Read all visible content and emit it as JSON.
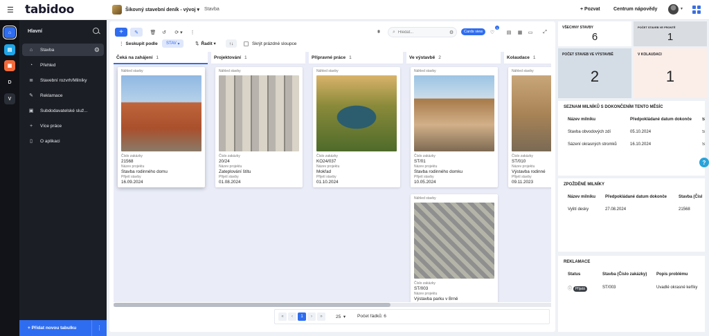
{
  "app": {
    "logo": "tabidoo"
  },
  "topbar": {
    "project": "Šikovný stavební deník - vývoj",
    "tab": "Stavba",
    "invite": "+ Pozvat",
    "help": "Centrum nápovědy"
  },
  "rail": [
    "",
    "",
    "",
    "D",
    "V"
  ],
  "sidebar": {
    "heading": "Hlavní",
    "items": [
      {
        "label": "Stavba",
        "icon": "home-icon"
      },
      {
        "label": "Přehled",
        "icon": "dashboard-icon"
      },
      {
        "label": "Stavební rozvrh/Milníky",
        "icon": "list-icon"
      },
      {
        "label": "Reklamace",
        "icon": "wrench-icon"
      },
      {
        "label": "Subdodavatelské služ...",
        "icon": "briefcase-icon"
      },
      {
        "label": "Více práce",
        "icon": "plus-icon"
      },
      {
        "label": "O aplikaci",
        "icon": "mobile-icon"
      }
    ],
    "add_table": "+ Přidat novou tabulku"
  },
  "toolbar": {
    "search_placeholder": "Hledat...",
    "cards_view": "Cards view",
    "notif_count": "1",
    "group_by": "Seskupit podle",
    "group_value": "STAV",
    "sort": "Řadit",
    "hide_empty": "Skrýt prázdné sloupce"
  },
  "columns": [
    {
      "title": "Čeká na zahájení",
      "count": "1"
    },
    {
      "title": "Projektování",
      "count": "1"
    },
    {
      "title": "Přípravné práce",
      "count": "1"
    },
    {
      "title": "Ve výstavbě",
      "count": "2"
    },
    {
      "title": "Kolaudace",
      "count": "1"
    }
  ],
  "card_labels": {
    "preview": "Náhled stavby",
    "order": "Číslo zakázky",
    "project": "Název projektu",
    "date": "Přijetí stavby"
  },
  "cards": [
    {
      "order": "21568",
      "project": "Stavba rodinného domu",
      "date": "16.09.2024"
    },
    {
      "order": "20/24",
      "project": "Zateplování štítu",
      "date": "01.08.2024"
    },
    {
      "order": "KO24/037",
      "project": "Mokřad",
      "date": "01.10.2024"
    },
    {
      "order": "ST/01",
      "project": "Stavba rodinného domku",
      "date": "10.05.2024"
    },
    {
      "order": "ST/010",
      "project": "Výstavba rodinné",
      "date": "09.11.2023"
    },
    {
      "order": "ST/003",
      "project": "Výstavba parku v Brně",
      "date": ""
    }
  ],
  "pager": {
    "current": "1",
    "per_page": "25",
    "rows": "Počet řádků: 6"
  },
  "stats": [
    {
      "title": "Všechny stavby",
      "value": "6"
    },
    {
      "title": "Počet staveb ve frontě",
      "value": "1"
    },
    {
      "title": "Počet staveb ve výstavbě",
      "value": "2"
    },
    {
      "title": "V kolaudaci",
      "value": "1"
    }
  ],
  "milestones": {
    "title": "Seznam milníků s dokončením tento měsíc",
    "headers": [
      "Název milníku",
      "Předpokládané datum dokonče",
      "S"
    ],
    "rows": [
      [
        "Stavba obvodových zdí",
        "05.10.2024",
        "S"
      ],
      [
        "Sázení okrasných stromků",
        "16.10.2024",
        "S"
      ]
    ]
  },
  "late": {
    "title": "Zpožděné milníky",
    "headers": [
      "Název milníku",
      "Předpokládané datum dokonče",
      "Stavba (Čísl"
    ],
    "rows": [
      [
        "Vylití desky",
        "27.08.2024",
        "21568"
      ]
    ]
  },
  "claims": {
    "title": "Reklamace",
    "headers": [
      "Status",
      "Stavba (Číslo zakázky)",
      "Popis problému"
    ],
    "rows": [
      [
        "Přijatá",
        "ST/003",
        "Uvadlé okrasné keříky"
      ]
    ]
  },
  "colors": {
    "accent": "#2f6df0",
    "sidebar": "#1b1e25",
    "stat_queue": "#d9dce1",
    "stat_build": "#d4dce6",
    "stat_kolaudace": "#fbeee9"
  }
}
